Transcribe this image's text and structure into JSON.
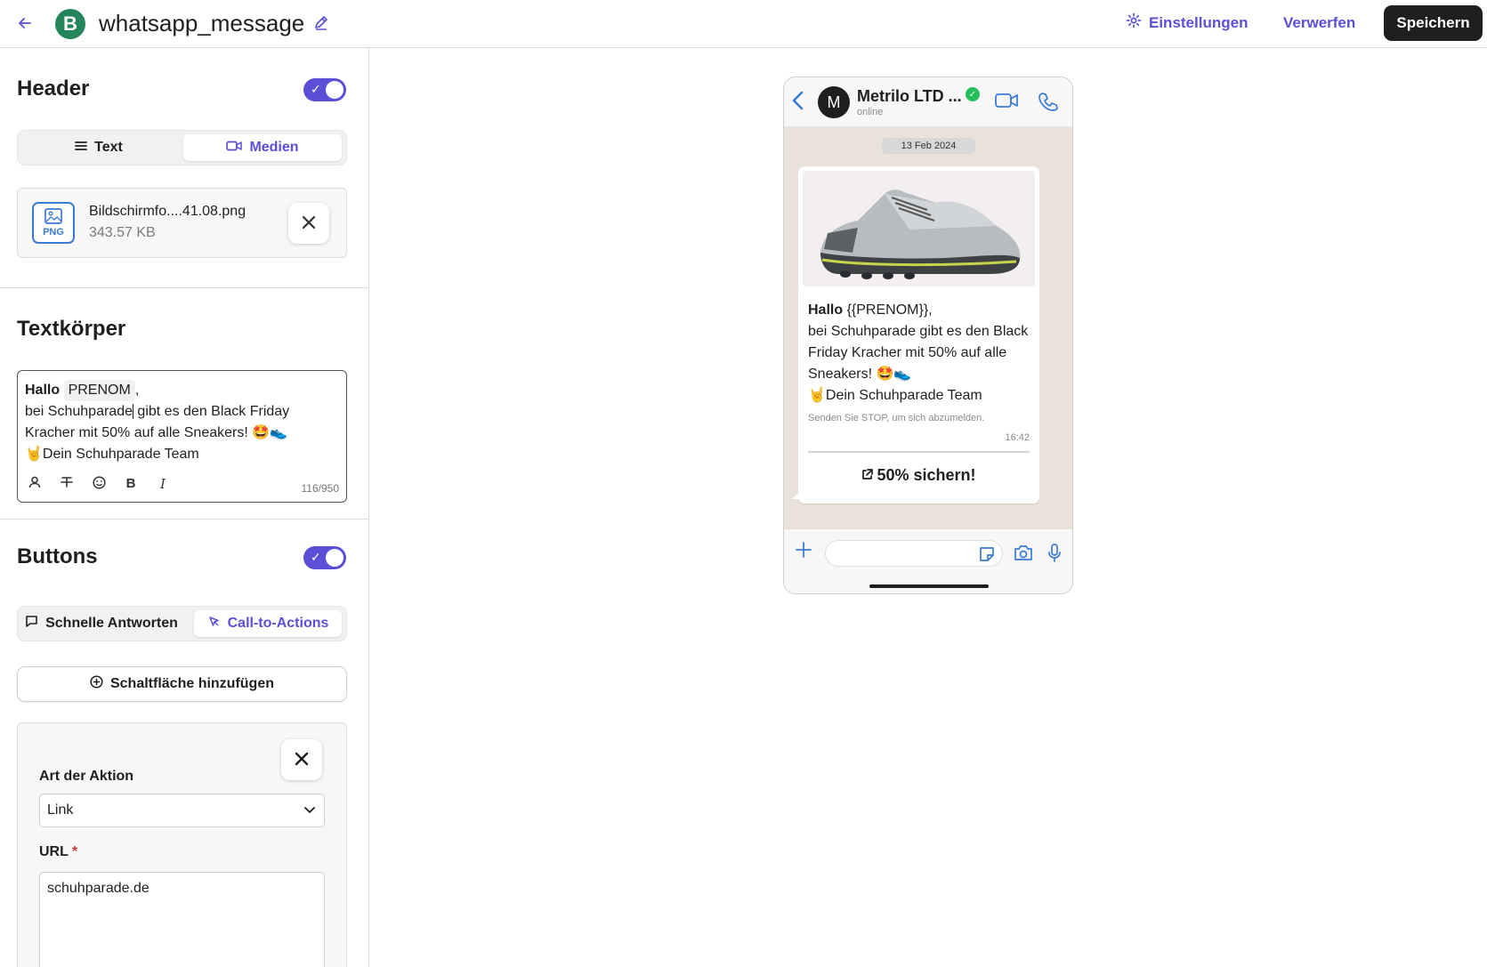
{
  "topbar": {
    "title": "whatsapp_message",
    "logo_letter": "B",
    "settings_label": "Einstellungen",
    "discard_label": "Verwerfen",
    "save_label": "Speichern"
  },
  "header_section": {
    "title": "Header",
    "toggle_on": true,
    "tabs": [
      {
        "label": "Text",
        "active": false
      },
      {
        "label": "Medien",
        "active": true
      }
    ],
    "file": {
      "badge": "PNG",
      "name": "Bildschirmfo....41.08.png",
      "size": "343.57 KB"
    }
  },
  "body_section": {
    "title": "Textkörper",
    "greeting": "Hallo",
    "variable": "PRENOM",
    "after_variable": ",",
    "line_before_cursor": "bei Schuhparade",
    "line_after_cursor": " gibt es den Black Friday Kracher mit 50% auf alle Sneakers! 🤩👟",
    "line_sign": "🤘Dein Schuhparade Team",
    "counter": "116/950"
  },
  "buttons_section": {
    "title": "Buttons",
    "toggle_on": true,
    "tabs": [
      {
        "label": "Schnelle Antworten",
        "active": false
      },
      {
        "label": "Call-to-Actions",
        "active": true
      }
    ],
    "add_label": "Schaltfläche hinzufügen",
    "action_type_label": "Art der Aktion",
    "action_type_value": "Link",
    "url_label": "URL",
    "url_required": "*",
    "url_value": "schuhparade.de"
  },
  "preview": {
    "contact_initial": "M",
    "contact_name": "Metrilo LTD ...",
    "status": "online",
    "date": "13 Feb 2024",
    "msg_greeting": "Hallo",
    "msg_rest": " {{PRENOM}},",
    "msg_line2": "bei Schuhparade gibt es den Black Friday Kracher mit 50% auf alle Sneakers! 🤩👟",
    "msg_line3": "🤘Dein Schuhparade Team",
    "footer": "Senden Sie STOP, um sich abzumelden.",
    "time": "16:42",
    "cta_label": "50% sichern!"
  }
}
